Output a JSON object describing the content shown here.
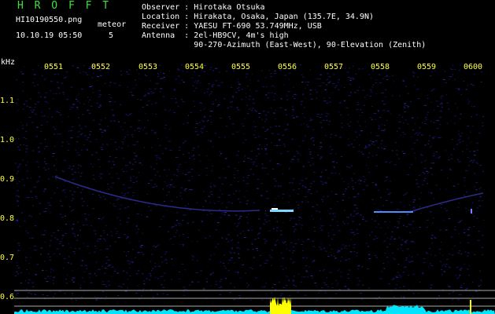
{
  "header": {
    "brand": "H R O F F T",
    "file_name": "HI10190550.png",
    "datetime": "10.10.19 05:50",
    "meteor_label": "meteor",
    "meteor_count": "5"
  },
  "station": {
    "observer": "Observer : Hirotaka Otsuka",
    "location": "Location : Hirakata, Osaka, Japan (135.7E, 34.9N)",
    "receiver": "Receiver : YAESU FT-690 53.749MHz, USB",
    "antenna": "Antenna  : 2el-HB9CV, 4m's high",
    "antenna_detail": "           90-270-Azimuth (East-West), 90-Elevation (Zenith)"
  },
  "axes": {
    "y_unit": "kHz",
    "time_ticks": [
      "0551",
      "0552",
      "0553",
      "0554",
      "0555",
      "0556",
      "0557",
      "0558",
      "0559",
      "0600"
    ],
    "freq_ticks": [
      "1.1",
      "1.0",
      "0.9",
      "0.8",
      "0.7",
      "0.6"
    ]
  },
  "colors": {
    "text": "#ffffff",
    "brand": "#3fe03f",
    "ticks": "#ffff3a",
    "background": "#000000",
    "noise": "#16166e",
    "echo": "#7fd8ff",
    "baseline": "#00e5ff",
    "burst": "#ffff00"
  }
}
